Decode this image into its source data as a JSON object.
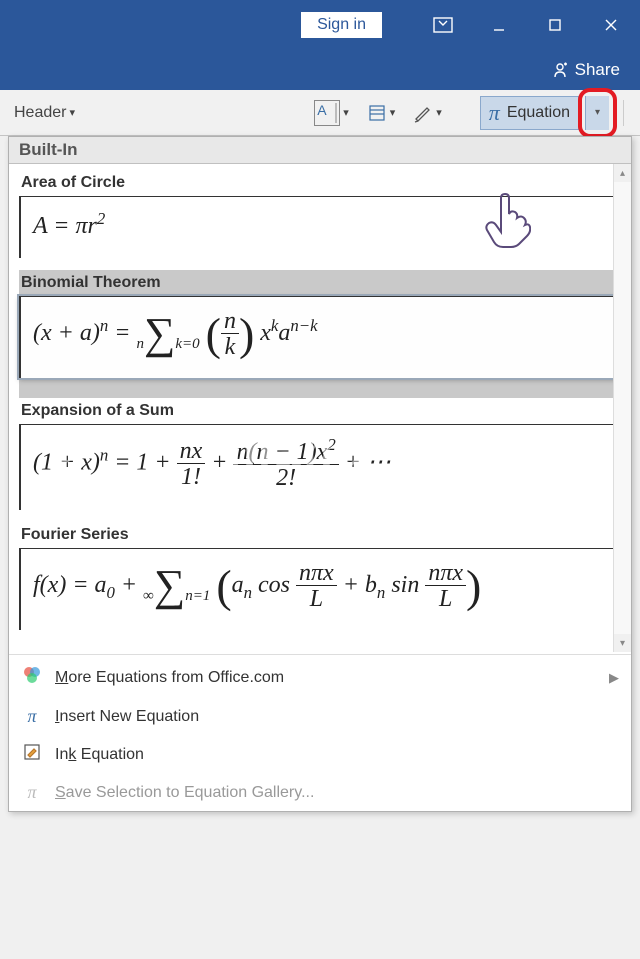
{
  "titlebar": {
    "sign_in": "Sign in"
  },
  "sharebar": {
    "share": "Share"
  },
  "ribbon": {
    "header": "Header",
    "equation": "Equation"
  },
  "dropdown": {
    "section": "Built-In",
    "items": [
      {
        "title": "Area of Circle",
        "formula_html": "<i>A</i> = <i>πr</i><span class='sup'>2</span>"
      },
      {
        "title": "Binomial Theorem",
        "formula_html": "(<i>x</i> + <i>a</i>)<span class='sup'><i>n</i></span> = <span class='sum-block'><span class='sum-top'>n</span><span class='sum-sym'>∑</span><span class='sum-bot'>k=0</span></span> <span class='big-paren'>(</span><span class='frac'><span class='num'><i>n</i></span><span class='den'><i>k</i></span></span><span class='big-paren'>)</span> <i>x</i><span class='sup'><i>k</i></span><i>a</i><span class='sup'><i>n−k</i></span>"
      },
      {
        "title": "Expansion of a Sum",
        "formula_html": "(1 + <i>x</i>)<span class='sup'><i>n</i></span> = 1 + <span class='frac'><span class='num'><i>nx</i></span><span class='den'>1!</span></span> + <span class='frac'><span class='num'><i>n</i>(<i>n</i> − 1)<i>x</i><span class='sup'>2</span></span><span class='den'>2!</span></span> + ⋯"
      },
      {
        "title": "Fourier Series",
        "formula_html": "<i>f</i>(<i>x</i>) = <i>a</i><span class='sub'>0</span> + <span class='sum-block'><span class='sum-top'>∞</span><span class='sum-sym'>∑</span><span class='sum-bot'>n=1</span></span> <span class='big-paren'>(</span><i>a</i><span class='sub'><i>n</i></span> cos <span class='frac'><span class='num'><i>nπx</i></span><span class='den'><i>L</i></span></span> + <i>b</i><span class='sub'><i>n</i></span> sin <span class='frac'><span class='num'><i>nπx</i></span><span class='den'><i>L</i></span></span><span class='big-paren'>)</span>"
      }
    ],
    "selected_index": 1,
    "menu": {
      "more": "More Equations from Office.com",
      "insert": "Insert New Equation",
      "ink": "Ink Equation",
      "save": "Save Selection to Equation Gallery..."
    }
  }
}
